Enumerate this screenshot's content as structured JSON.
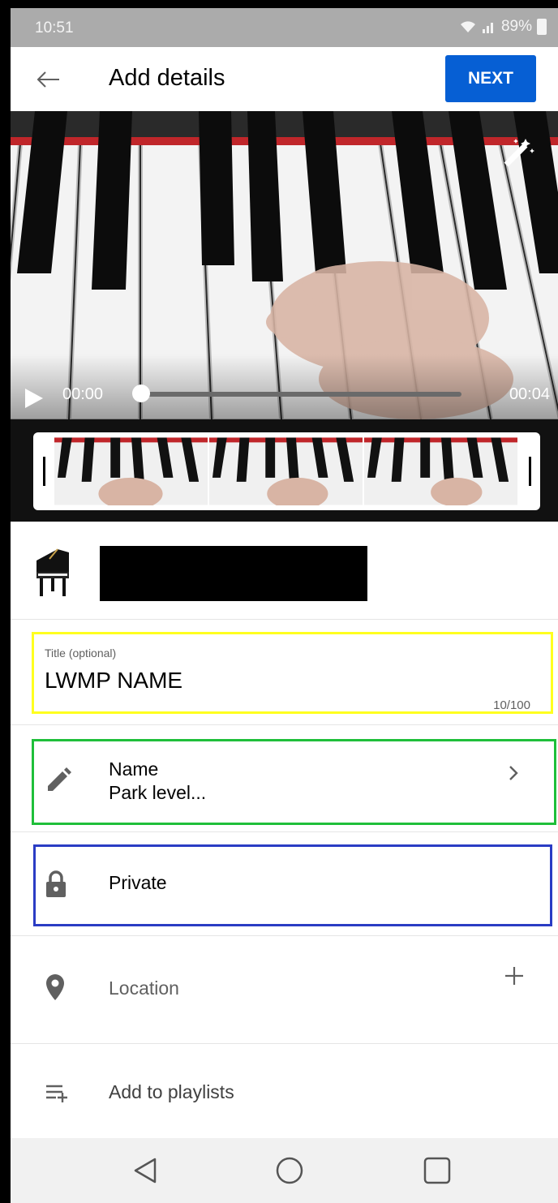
{
  "status_bar": {
    "time": "10:51",
    "battery": "89%",
    "icons": [
      "wifi-icon",
      "signal-icon",
      "battery-icon"
    ]
  },
  "header": {
    "title": "Add details",
    "next_label": "NEXT",
    "back_icon": "arrow-left-icon"
  },
  "video": {
    "current_time": "00:00",
    "duration": "00:04",
    "progress": 0.0,
    "effects_icon": "magic-wand-icon"
  },
  "channel": {
    "avatar": "grand-piano-icon"
  },
  "title_field": {
    "label": "Title (optional)",
    "value": "LWMP NAME",
    "counter": "10/100",
    "highlight": "#ffff1f"
  },
  "description_row": {
    "label": "Name",
    "value": "Park level...",
    "icon": "pencil-icon",
    "highlight": "#1fbf3a"
  },
  "visibility_row": {
    "label": "Private",
    "icon": "lock-icon",
    "highlight": "#2a3cc4"
  },
  "location_row": {
    "label": "Location",
    "icon": "location-pin-icon"
  },
  "playlist_row": {
    "label": "Add to playlists",
    "icon": "playlist-add-icon"
  },
  "nav_bar": {
    "buttons": [
      "back-triangle-icon",
      "home-circle-icon",
      "recents-square-icon"
    ]
  },
  "colors": {
    "accent": "#065fd4"
  }
}
